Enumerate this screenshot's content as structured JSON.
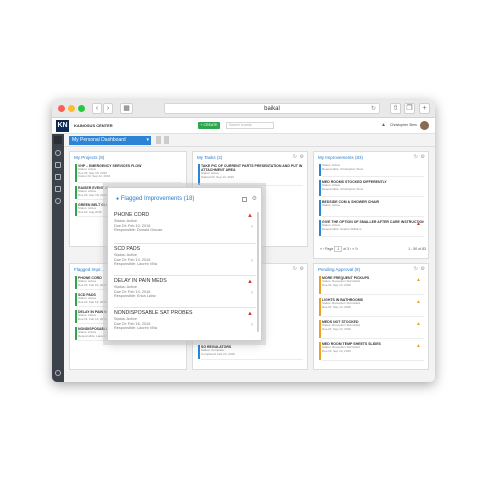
{
  "browser": {
    "url": "baikal",
    "colors": {
      "close": "#fd5f57",
      "minimize": "#fdbc2e",
      "zoom": "#27c840"
    }
  },
  "app": {
    "company": "KAINOSUS CENTER",
    "create_label": "+ CREATE",
    "search_placeholder": "Search boards",
    "user_name": "Christopher Sims",
    "dashboard_label": "My Personal Dashboard"
  },
  "panels": {
    "projects": {
      "title": "My Projects (9)",
      "items": [
        {
          "title": "VHP – EMERGENCY SERVICES FLOW",
          "lines": [
            "Status: Active",
            "Due Dt: Sep 18, 2016",
            "Owner Dt: Sep 12, 2016"
          ]
        },
        {
          "title": "RAISER EVENT, M...",
          "lines": [
            "Status: Active",
            "Due Dt: Sep 18, 2016"
          ]
        },
        {
          "title": "GREEN BELT GLO...",
          "lines": [
            "Status: Active",
            "Due Dt: Aug 2016"
          ]
        }
      ]
    },
    "tasks": {
      "title": "My Tasks (2)",
      "items": [
        {
          "title": "TAKE PIC OF CURRENT PARTS PRESENTATION AND PUT IN ATTACHMENT AREA",
          "lines": [
            "Status: Active",
            "Started Dt: Sep 13, 2016",
            "Action Dt: Sep 13, 2016"
          ]
        }
      ]
    },
    "improvements": {
      "title": "My Improvements (83)",
      "items": [
        {
          "title": "MED ROOMS STOCKED DIFFERENTLY",
          "lines": [
            "Status: Active",
            "Responsible: Christopher Sims"
          ]
        },
        {
          "title": "BEDSIDE COM & SHOWER CHAIR",
          "lines": [
            "Status: Active",
            "Responsible: Christopher Sims"
          ]
        },
        {
          "title": "GIVE THE OPTION OF SMALLER AFTER CARE INSTRUCTIONS",
          "lines": [
            "Status: Active",
            "Responsible: Sophie Williams"
          ]
        }
      ],
      "pager": {
        "label": "Page",
        "page": "1",
        "of": "of 3",
        "range": "1 - 50 of 83"
      }
    },
    "flagged_bg": {
      "title": "Flagged Impr...",
      "items": [
        {
          "title": "PHONE CORD",
          "lines": [
            "Status: Active",
            "Due Dt: Feb 10, 2016"
          ]
        },
        {
          "title": "SCD PADS",
          "lines": [
            "Status: Active",
            "Due Dt: Feb 14, 2016"
          ]
        },
        {
          "title": "DELAY IN PAIN MEDS",
          "lines": [
            "Status: Active",
            "Due Dt: Feb 14, 2016"
          ]
        },
        {
          "title": "NONDISPOSABLE SAT PROBES",
          "lines": [
            "Status: Active",
            "Responsible: Lauren Villa"
          ]
        }
      ]
    },
    "middle": {
      "items": [
        {
          "title": "SO REGULATORS",
          "lines": [
            "Status: Complete",
            "Completed: Feb 23, 2016"
          ]
        }
      ]
    },
    "pending": {
      "title": "Pending Approval (9)",
      "items": [
        {
          "title": "MORE FREQUENT PICKUPS",
          "lines": [
            "Status: Reception Submitted",
            "Due Dt: Sep 13, 2016"
          ]
        },
        {
          "title": "LIGHTS IN BATHROOMS",
          "lines": [
            "Status: Reception Submitted",
            "Due Dt: Sep 13, 2016"
          ]
        },
        {
          "title": "MEDS NOT STOCKED",
          "lines": [
            "Status: Reception Submitted",
            "Due Dt: Sep 13, 2016"
          ]
        },
        {
          "title": "MED ROOM TEMP SHEETS SLIDES",
          "lines": [
            "Status: Reception Submitted",
            "Due Dt: Sep 13, 2016"
          ]
        }
      ]
    }
  },
  "modal": {
    "title": "Flagged Improvements (18)",
    "items": [
      {
        "title": "PHONE CORD",
        "status": "Status: Active",
        "due": "Due Dt: Feb 10, 2016",
        "resp": "Responsible: Donald Grouse",
        "flag": true
      },
      {
        "title": "SCD PADS",
        "status": "Status: Active",
        "due": "Due Dt: Feb 14, 2016",
        "resp": "Responsible: Lauren Villa",
        "flag": false
      },
      {
        "title": "DELAY IN PAIN MEDS",
        "status": "Status: Active",
        "due": "Due Dt: Feb 14, 2016",
        "resp": "Responsible: Erica Lainz",
        "flag": true
      },
      {
        "title": "NONDISPOSABLE SAT PROBES",
        "status": "Status: Active",
        "due": "Due Dt: Feb 16, 2016",
        "resp": "Responsible: Lauren Villa",
        "flag": true
      }
    ]
  }
}
